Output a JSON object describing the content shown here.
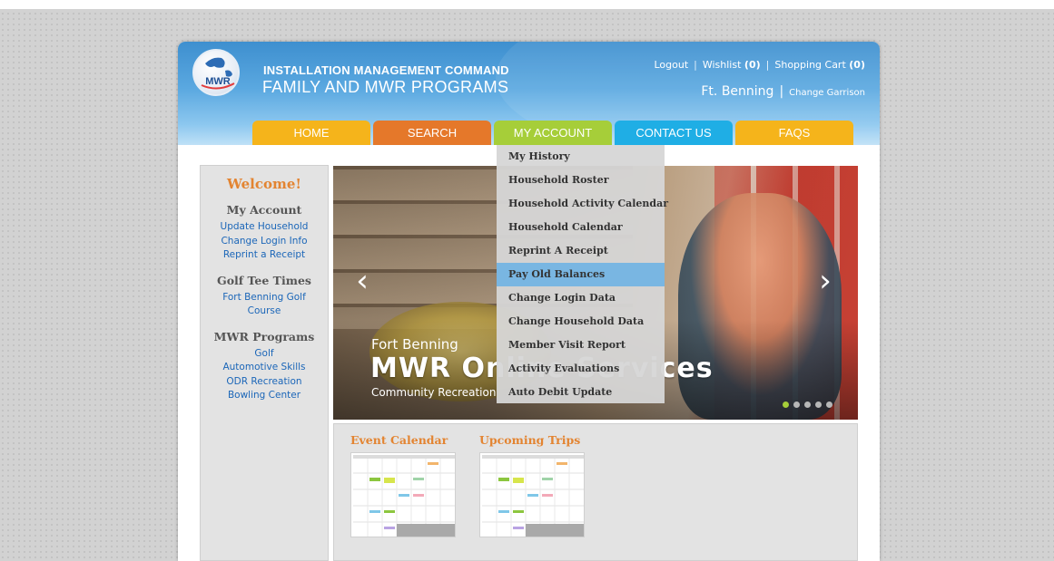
{
  "header": {
    "title_line1": "INSTALLATION MANAGEMENT COMMAND",
    "title_line2": "FAMILY AND MWR PROGRAMS",
    "logo_text": "MWR",
    "top_links": {
      "logout": "Logout",
      "wishlist_label": "Wishlist",
      "wishlist_count": "(0)",
      "cart_label": "Shopping Cart",
      "cart_count": "(0)"
    },
    "garrison_name": "Ft. Benning",
    "change_garrison": "Change Garrison"
  },
  "nav": {
    "tabs": [
      {
        "label": "HOME",
        "color": "#f5b41b"
      },
      {
        "label": "SEARCH",
        "color": "#e5782a"
      },
      {
        "label": "MY ACCOUNT",
        "color": "#a6ce39"
      },
      {
        "label": "CONTACT US",
        "color": "#1faee5"
      },
      {
        "label": "FAQS",
        "color": "#f5b41b"
      }
    ],
    "active_tab": "MY ACCOUNT"
  },
  "dropdown": {
    "items": [
      "My History",
      "Household Roster",
      "Household Activity Calendar",
      "Household Calendar",
      "Reprint A Receipt",
      "Pay Old Balances",
      "Change Login Data",
      "Change Household Data",
      "Member Visit Report",
      "Activity Evaluations",
      "Auto Debit Update"
    ],
    "highlighted": "Pay Old Balances"
  },
  "sidebar": {
    "welcome": "Welcome!",
    "my_account": {
      "heading": "My Account",
      "links": [
        "Update Household",
        "Change Login Info",
        "Reprint a Receipt"
      ]
    },
    "golf": {
      "heading": "Golf Tee Times",
      "links": [
        "Fort Benning Golf Course"
      ]
    },
    "programs": {
      "heading": "MWR Programs",
      "links": [
        "Golf",
        "Automotive Skills",
        "ODR Recreation",
        "Bowling Center"
      ]
    }
  },
  "hero": {
    "caption_small": "Fort Benning",
    "caption_big": "MWR Online Services",
    "caption_sub": "Community Recreation",
    "slides": 5,
    "active_slide": 1
  },
  "bottom": {
    "event_calendar": "Event Calendar",
    "upcoming_trips": "Upcoming Trips"
  },
  "colors": {
    "accent_orange": "#e38431",
    "link_blue": "#1b66b8",
    "highlight": "#79b6e2",
    "dot_active": "#a6ce39"
  }
}
